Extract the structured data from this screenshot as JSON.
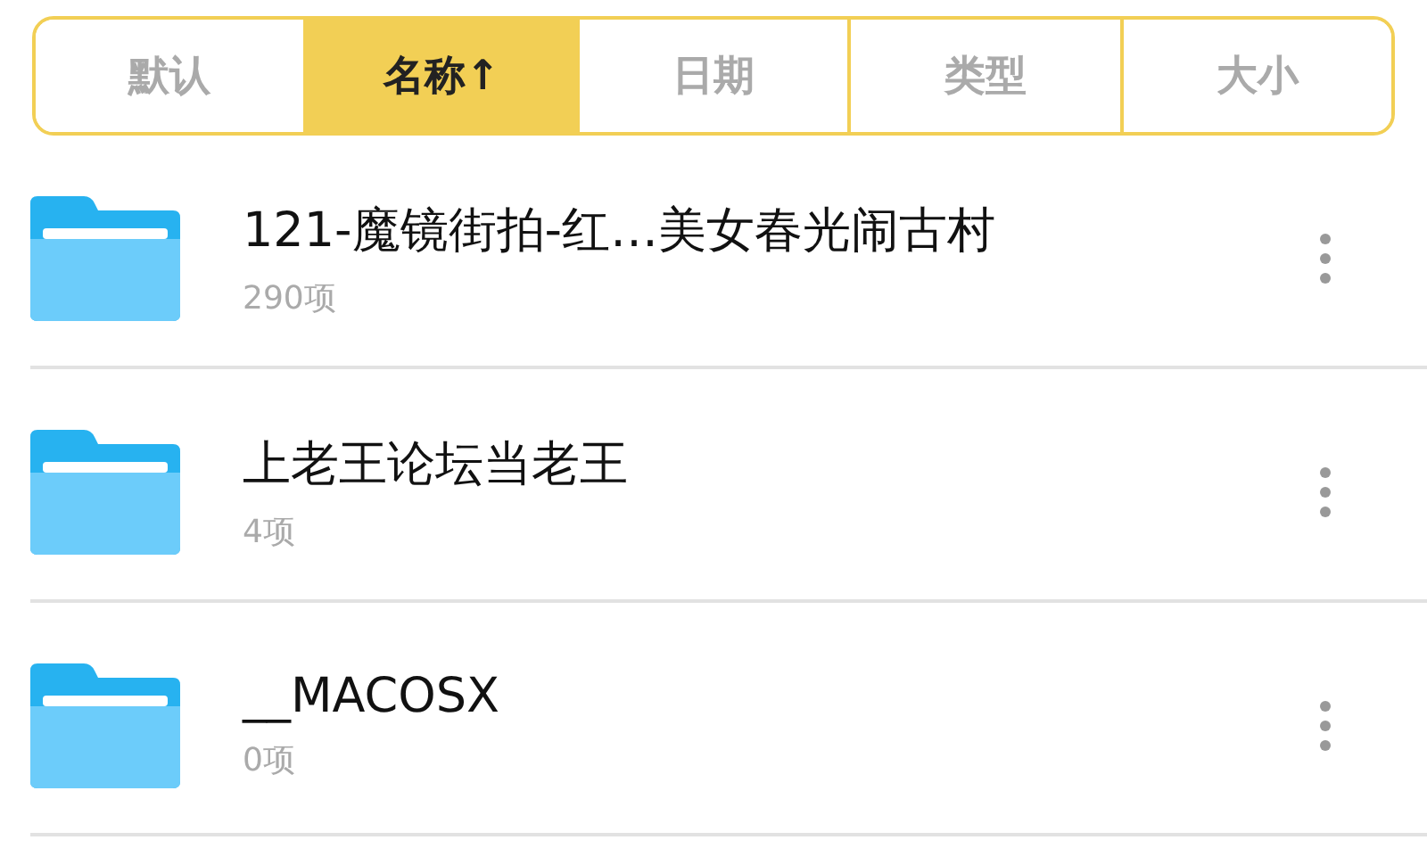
{
  "sort_tabs": [
    {
      "label": "默认",
      "selected": false
    },
    {
      "label": "名称↑",
      "selected": true
    },
    {
      "label": "日期",
      "selected": false
    },
    {
      "label": "类型",
      "selected": false
    },
    {
      "label": "大小",
      "selected": false
    }
  ],
  "folders": [
    {
      "name": "121-魔镜街拍-红…美女春光闹古村",
      "count": "290项"
    },
    {
      "name": "上老王论坛当老王",
      "count": "4项"
    },
    {
      "name": "__MACOSX",
      "count": "0项"
    }
  ]
}
